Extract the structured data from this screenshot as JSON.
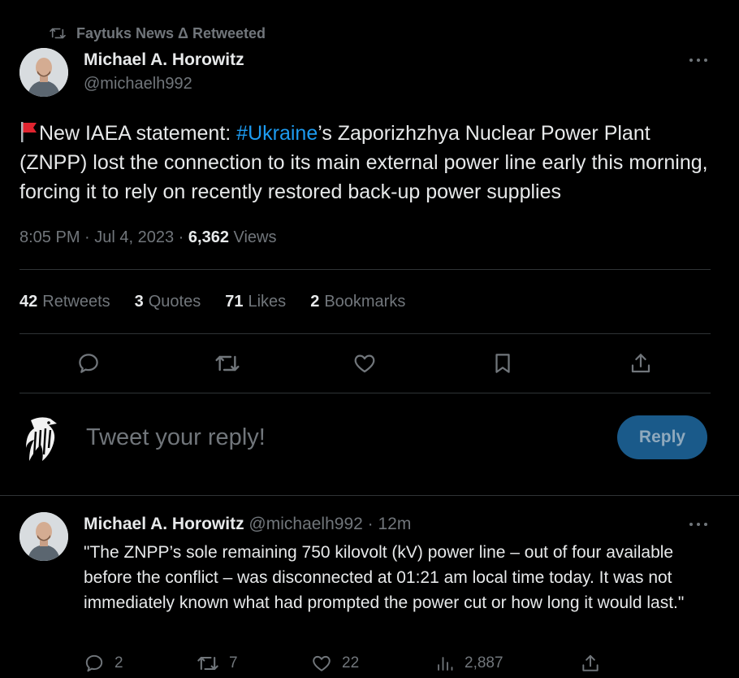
{
  "retweet_header": {
    "label": "Faytuks News Δ Retweeted"
  },
  "tweet": {
    "author_name": "Michael A. Horowitz",
    "author_handle": "@michaelh992",
    "text_before": "New IAEA statement: ",
    "hashtag": "#Ukraine",
    "text_after": "’s Zaporizhzhya Nuclear Power Plant (ZNPP) lost the connection to its main external power line early this morning, forcing it to rely on recently restored back-up power supplies",
    "timestamp": "8:05 PM · Jul 4, 2023 · ",
    "views_count": "6,362",
    "views_label": " Views"
  },
  "stats": [
    {
      "count": "42",
      "label": "Retweets"
    },
    {
      "count": "3",
      "label": "Quotes"
    },
    {
      "count": "71",
      "label": "Likes"
    },
    {
      "count": "2",
      "label": "Bookmarks"
    }
  ],
  "actions": [
    "reply-icon",
    "retweet-icon",
    "like-icon",
    "bookmark-icon",
    "share-icon"
  ],
  "reply_box": {
    "placeholder": "Tweet your reply!",
    "button_label": "Reply"
  },
  "reply_tweet": {
    "author_name": "Michael A. Horowitz",
    "author_handle": "@michaelh992 · 12m",
    "text": "\"The ZNPP’s sole remaining 750 kilovolt (kV) power line – out of four available before the conflict – was disconnected at 01:21 am local time today. It was not immediately known what had prompted the power cut or how long it would last.\"",
    "replies": "2",
    "retweets": "7",
    "likes": "22",
    "views": "2,887"
  },
  "colors": {
    "background": "#000000",
    "text": "#e7e9ea",
    "muted": "#71767b",
    "link": "#1d9bf0",
    "reply_button_bg": "#1a5a8a",
    "divider": "#2f3336"
  }
}
